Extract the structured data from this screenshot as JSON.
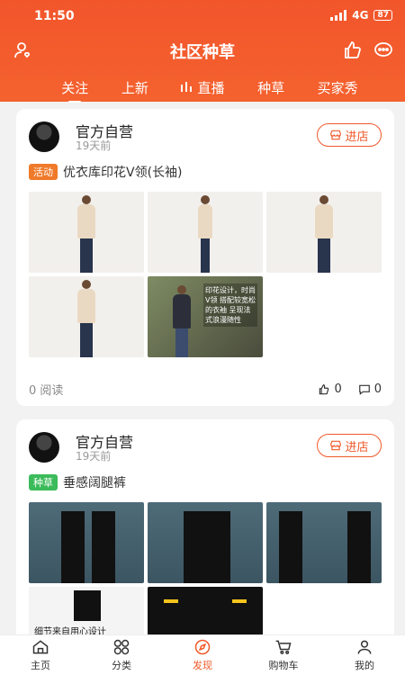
{
  "status": {
    "time": "11:50",
    "network": "4G",
    "battery": "87"
  },
  "header": {
    "title": "社区种草",
    "tabs": [
      "关注",
      "上新",
      "直播",
      "种草",
      "买家秀"
    ],
    "active_tab": "关注"
  },
  "posts": [
    {
      "author": "官方自营",
      "time": "19天前",
      "store_button": "进店",
      "badge": "活动",
      "text": "优衣库印花V领(长袖)",
      "image_caption": "印花设计，时尚V领 搭配较宽松的衣袖 呈现法式浪漫随性",
      "reads": "0 阅读",
      "likes": "0",
      "comments": "0"
    },
    {
      "author": "官方自营",
      "time": "19天前",
      "store_button": "进店",
      "badge": "种草",
      "text": "垂感阔腿裤",
      "detail_caption": "细节来自用心设计"
    }
  ],
  "bottom_nav": [
    "主页",
    "分类",
    "发现",
    "购物车",
    "我的"
  ],
  "colors": {
    "accent": "#f05a2b",
    "header": "#f2552b",
    "activity_badge": "#f07a2a",
    "seed_badge": "#3bbb5a"
  }
}
